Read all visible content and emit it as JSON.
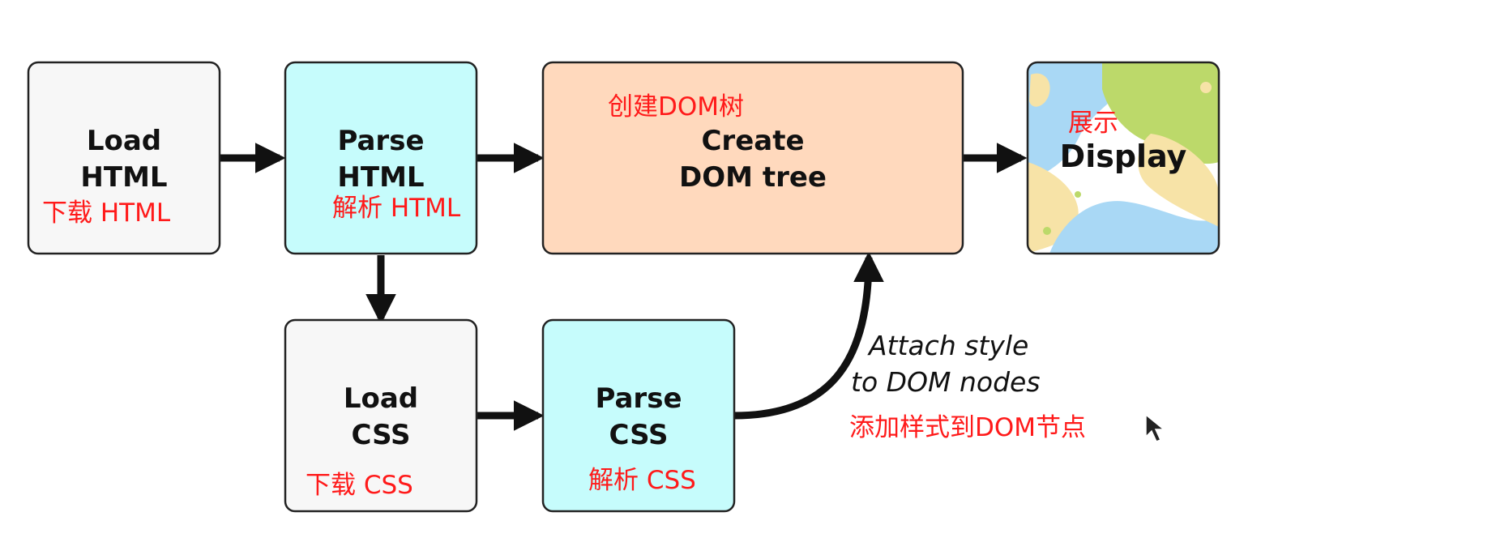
{
  "colors": {
    "box_white": "#f7f7f7",
    "box_cyan": "#c6fcfc",
    "box_peach": "#ffd9bd",
    "stroke": "#222222",
    "annotation_red": "#ff1a1a"
  },
  "nodes": {
    "load_html": {
      "line1": "Load",
      "line2": "HTML",
      "note": "下载 HTML"
    },
    "parse_html": {
      "line1": "Parse",
      "line2": "HTML",
      "note": "解析 HTML"
    },
    "create_dom": {
      "line1": "Create",
      "line2": "DOM tree",
      "note": "创建DOM树"
    },
    "display": {
      "line1": "Display",
      "note": "展示"
    },
    "load_css": {
      "line1": "Load",
      "line2": "CSS",
      "note": "下载 CSS"
    },
    "parse_css": {
      "line1": "Parse",
      "line2": "CSS",
      "note": "解析 CSS"
    }
  },
  "attach_label": {
    "line1": "Attach style",
    "line2": "to DOM nodes",
    "note": "添加样式到DOM节点"
  },
  "icons": [
    "cursor-icon",
    "display-abstract-pattern-icon"
  ]
}
